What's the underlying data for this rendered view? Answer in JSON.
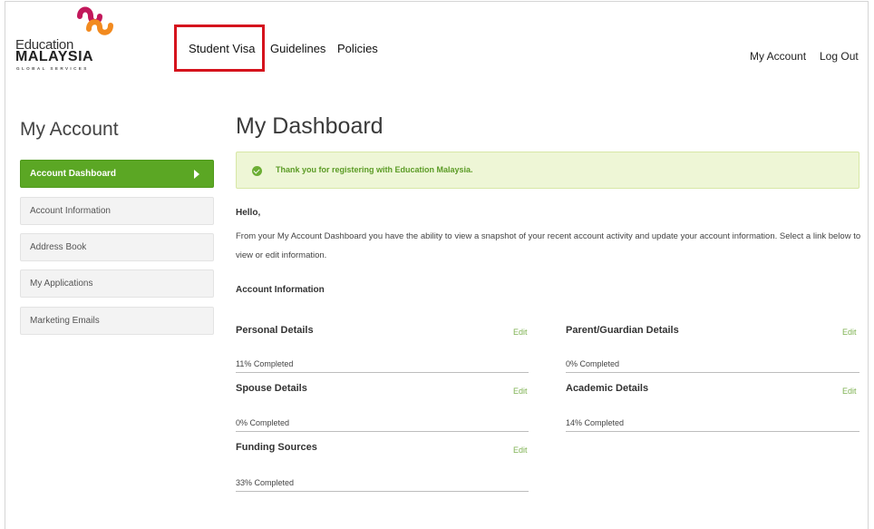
{
  "logo": {
    "line1": "Education",
    "line2": "MALAYSIA",
    "line3": "GLOBAL SERVICES"
  },
  "nav": {
    "items": [
      "Student Visa",
      "Guidelines",
      "Policies"
    ]
  },
  "account_links": {
    "my_account": "My Account",
    "log_out": "Log Out"
  },
  "sidebar": {
    "title": "My Account",
    "items": [
      {
        "label": "Account Dashboard"
      },
      {
        "label": "Account Information"
      },
      {
        "label": "Address Book"
      },
      {
        "label": "My Applications"
      },
      {
        "label": "Marketing Emails"
      }
    ]
  },
  "main": {
    "title": "My Dashboard",
    "notice": "Thank you for registering with Education Malaysia.",
    "greeting": "Hello,",
    "intro": "From your My Account Dashboard you have the ability to view a snapshot of your recent account activity and update your account information. Select a link below to view or edit information.",
    "section_heading": "Account Information",
    "edit_label": "Edit",
    "sections": [
      {
        "title": "Personal Details",
        "progress": "11% Completed"
      },
      {
        "title": "Parent/Guardian Details",
        "progress": "0% Completed"
      },
      {
        "title": "Spouse Details",
        "progress": "0% Completed"
      },
      {
        "title": "Academic Details",
        "progress": "14% Completed"
      },
      {
        "title": "Funding Sources",
        "progress": "33% Completed"
      }
    ]
  },
  "colors": {
    "accent_green": "#5ba724",
    "highlight_red": "#d5131d",
    "logo_orange": "#f28a1f",
    "logo_magenta": "#c2185b"
  }
}
